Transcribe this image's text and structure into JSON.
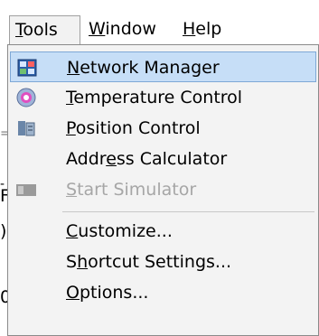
{
  "menubar": {
    "tools": "Tools",
    "tools_u": "T",
    "tools_rest": "ools",
    "window_u": "W",
    "window_rest": "indow",
    "help_u": "H",
    "help_rest": "elp"
  },
  "background_fragments": {
    "f1": "-",
    "f2": "F",
    "f3": ")",
    "f4": "0"
  },
  "menu": {
    "items": [
      {
        "u": "N",
        "rest": "etwork Manager",
        "icon": "network-manager-icon",
        "state": "highlighted"
      },
      {
        "u": "T",
        "rest": "emperature Control",
        "icon": "temperature-control-icon",
        "state": "normal"
      },
      {
        "u": "P",
        "rest": "osition Control",
        "icon": "position-control-icon",
        "state": "normal"
      },
      {
        "pre": "Addr",
        "u": "e",
        "rest": "ss Calculator",
        "icon": "",
        "state": "normal"
      },
      {
        "u": "S",
        "rest": "tart Simulator",
        "icon": "start-simulator-icon",
        "state": "disabled"
      },
      {
        "u": "C",
        "rest": "ustomize...",
        "icon": "",
        "state": "normal"
      },
      {
        "pre": "S",
        "u": "h",
        "rest": "ortcut Settings...",
        "icon": "",
        "state": "normal"
      },
      {
        "u": "O",
        "rest": "ptions...",
        "icon": "",
        "state": "normal"
      }
    ]
  },
  "colors": {
    "highlight_fill": "#c6def7",
    "highlight_border": "#7ea8d6",
    "disabled_text": "#a6a6a6",
    "menu_bg": "#f3f3f3"
  }
}
